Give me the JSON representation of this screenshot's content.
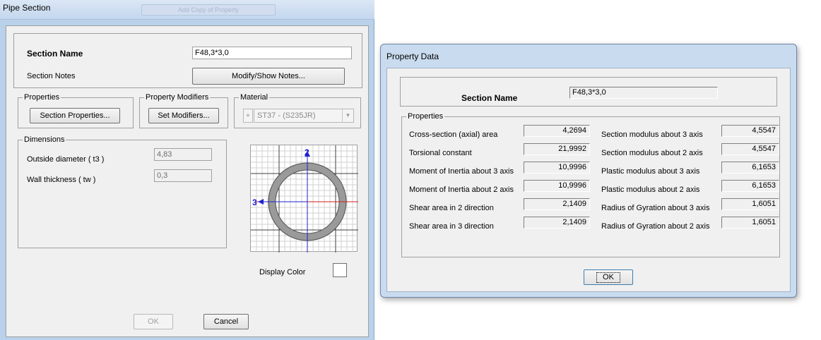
{
  "pipe_section": {
    "title": "Pipe Section",
    "background_tab_text": "Add Copy of Property",
    "section_name_label": "Section Name",
    "section_name_value": "F48,3*3,0",
    "section_notes_label": "Section Notes",
    "modify_notes_button": "Modify/Show Notes...",
    "properties_group": "Properties",
    "section_properties_button": "Section Properties...",
    "modifiers_group": "Property Modifiers",
    "set_modifiers_button": "Set Modifiers...",
    "material_group": "Material",
    "material_plus": "+",
    "material_value": "ST37 - (S235JR)",
    "dimensions_group": "Dimensions",
    "outside_diameter_label": "Outside diameter  ( t3 )",
    "outside_diameter_value": "4,83",
    "wall_thickness_label": "Wall thickness  ( tw )",
    "wall_thickness_value": "0,3",
    "axis_2_label": "2",
    "axis_3_label": "3",
    "display_color_label": "Display Color",
    "ok_button": "OK",
    "cancel_button": "Cancel"
  },
  "property_data": {
    "title": "Property Data",
    "section_name_label": "Section Name",
    "section_name_value": "F48,3*3,0",
    "properties_group": "Properties",
    "left_rows": [
      {
        "label": "Cross-section (axial) area",
        "value": "4,2694"
      },
      {
        "label": "Torsional constant",
        "value": "21,9992"
      },
      {
        "label": "Moment of Inertia about 3 axis",
        "value": "10,9996"
      },
      {
        "label": "Moment of Inertia about 2 axis",
        "value": "10,9996"
      },
      {
        "label": "Shear area in 2 direction",
        "value": "2,1409"
      },
      {
        "label": "Shear area in 3 direction",
        "value": "2,1409"
      }
    ],
    "right_rows": [
      {
        "label": "Section modulus about 3 axis",
        "value": "4,5547"
      },
      {
        "label": "Section modulus about 2 axis",
        "value": "4,5547"
      },
      {
        "label": "Plastic modulus about 3 axis",
        "value": "6,1653"
      },
      {
        "label": "Plastic modulus about 2 axis",
        "value": "6,1653"
      },
      {
        "label": "Radius of Gyration about 3 axis",
        "value": "1,6051"
      },
      {
        "label": "Radius of Gyration about 2 axis",
        "value": "1,6051"
      }
    ],
    "ok_button": "OK"
  }
}
